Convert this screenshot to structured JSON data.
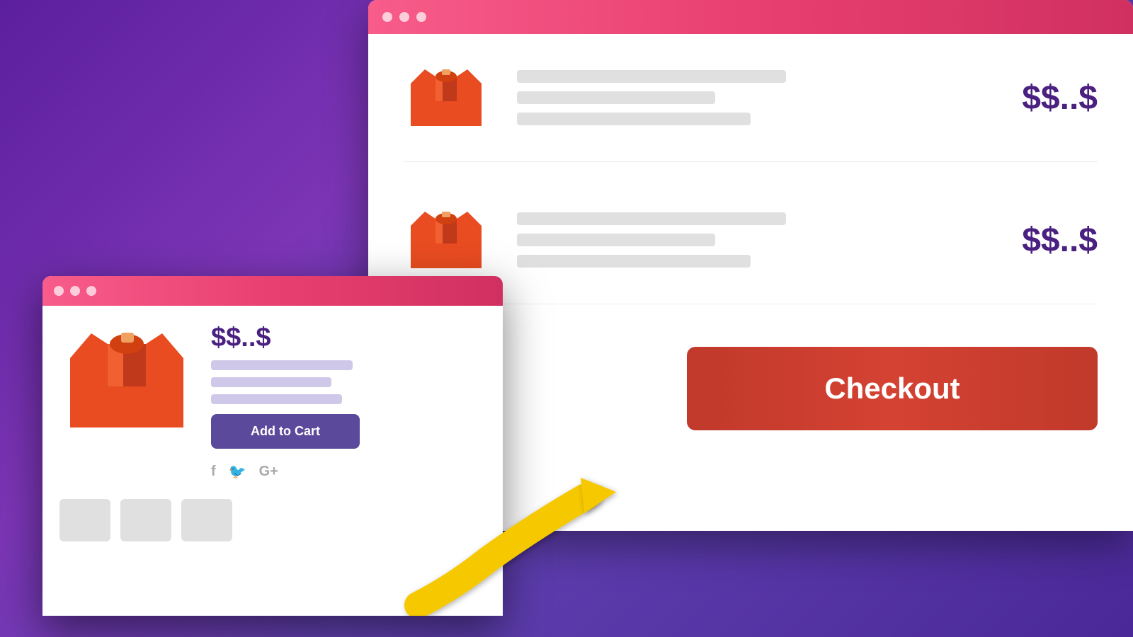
{
  "background": {
    "color_start": "#4a1a8a",
    "color_end": "#3a2080"
  },
  "browser_back": {
    "titlebar_dots": [
      "dot1",
      "dot2",
      "dot3"
    ],
    "products": [
      {
        "price": "$$..$",
        "bars": [
          "long",
          "medium",
          "short"
        ]
      },
      {
        "price": "$$..$",
        "bars": [
          "long",
          "medium",
          "short"
        ]
      }
    ],
    "checkout_label": "Checkout"
  },
  "browser_front": {
    "titlebar_dots": [
      "dot1",
      "dot2",
      "dot3"
    ],
    "price_label": "$$..$",
    "add_to_cart_label": "Add to Cart",
    "social_icons": [
      "f",
      "𝕏",
      "G+"
    ],
    "detail_bars": 3,
    "thumbnails": 3
  },
  "arrow": {
    "color": "#f5c800",
    "direction": "upper-right"
  }
}
